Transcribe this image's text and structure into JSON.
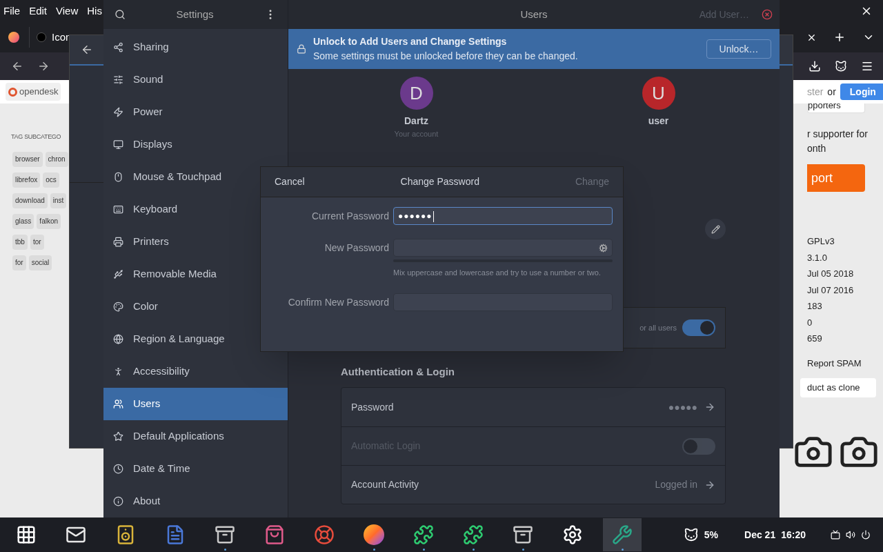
{
  "browser": {
    "menu": [
      "File",
      "Edit",
      "View",
      "His"
    ],
    "tab_title": "Icon",
    "site": "opendesk",
    "tag_heading": "TAG SUBCATEGO",
    "tags": [
      [
        "browser",
        "chron"
      ],
      [
        "librefox",
        "ocs"
      ],
      [
        "download",
        "inst"
      ],
      [
        "glass",
        "falkon"
      ],
      [
        "tbb",
        "tor"
      ],
      [
        "for",
        "social"
      ]
    ],
    "login_prefix": "ster",
    "login_or": "or",
    "login_button": "Login",
    "supporters_cut": "pporters",
    "supporter_text": [
      "r supporter for",
      "onth"
    ],
    "support_button": "port",
    "facts": [
      "GPLv3",
      "3.1.0",
      "Jul 05 2018",
      "Jul 07 2016",
      "183",
      "0",
      "659"
    ],
    "report_link": "Report SPAM",
    "clone_button": "duct as clone"
  },
  "settings": {
    "title": "Settings",
    "sidebar": [
      {
        "label": "Sharing",
        "selected": false
      },
      {
        "label": "Sound",
        "selected": false
      },
      {
        "label": "Power",
        "selected": false
      },
      {
        "label": "Displays",
        "selected": false
      },
      {
        "label": "Mouse & Touchpad",
        "selected": false
      },
      {
        "label": "Keyboard",
        "selected": false
      },
      {
        "label": "Printers",
        "selected": false
      },
      {
        "label": "Removable Media",
        "selected": false
      },
      {
        "label": "Color",
        "selected": false
      },
      {
        "label": "Region & Language",
        "selected": false
      },
      {
        "label": "Accessibility",
        "selected": false
      },
      {
        "label": "Users",
        "selected": true
      },
      {
        "label": "Default Applications",
        "selected": false
      },
      {
        "label": "Date & Time",
        "selected": false
      },
      {
        "label": "About",
        "selected": false
      }
    ],
    "panel_title": "Users",
    "add_user": {
      "label": "Add User…",
      "disabled": true
    },
    "banner": {
      "title": "Unlock to Add Users and Change Settings",
      "text": "Some settings must be unlocked before they can be changed.",
      "button": "Unlock…"
    },
    "accounts": [
      {
        "initial": "D",
        "name": "Dartz",
        "note": "Your account",
        "color": "#6b3a8c"
      },
      {
        "initial": "U",
        "name": "user",
        "color": "#b8262a"
      }
    ],
    "admin_row": {
      "text": "or all users",
      "on": true
    },
    "section_title": "Authentication & Login",
    "rows": [
      {
        "kind": "link",
        "label": "Password",
        "value": "●●●●●",
        "disabled": false
      },
      {
        "kind": "switch",
        "label": "Automatic Login",
        "on": false,
        "disabled": true
      },
      {
        "kind": "link",
        "label": "Account Activity",
        "value": "Logged in",
        "disabled": false
      }
    ]
  },
  "dialog": {
    "cancel": "Cancel",
    "title": "Change Password",
    "confirm": {
      "label": "Change",
      "disabled": true
    },
    "fields": [
      {
        "label": "Current Password",
        "value": "●●●●●●",
        "focused": true
      },
      {
        "label": "New Password",
        "generate": true,
        "focused": false,
        "level": 0,
        "hint": "Mix uppercase and lowercase and try to use a number or two."
      },
      {
        "label": "Confirm New Password",
        "focused": false
      }
    ]
  },
  "taskbar": {
    "apps": [
      {
        "running": false,
        "active": false
      },
      {
        "running": false,
        "active": false
      },
      {
        "running": false,
        "active": false
      },
      {
        "running": false,
        "active": false
      },
      {
        "running": true,
        "active": false
      },
      {
        "running": false,
        "active": false
      },
      {
        "running": false,
        "active": false
      },
      {
        "running": true,
        "active": false
      },
      {
        "running": true,
        "active": false
      },
      {
        "running": true,
        "active": false
      },
      {
        "running": true,
        "active": false
      },
      {
        "running": false,
        "active": false
      },
      {
        "running": true,
        "active": true
      }
    ],
    "battery": "5%",
    "date": "Dec 21",
    "time": "16:20"
  }
}
